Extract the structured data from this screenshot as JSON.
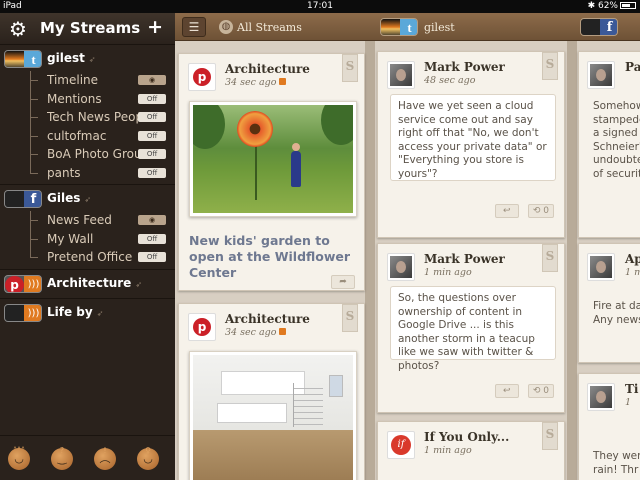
{
  "status": {
    "device": "iPad",
    "time": "17:01",
    "battery": "62%"
  },
  "sidebar": {
    "title": "My Streams",
    "accounts": [
      {
        "name": "gilest",
        "feeds": [
          {
            "label": "Timeline",
            "toggle": "on"
          },
          {
            "label": "Mentions",
            "toggle": "Off"
          },
          {
            "label": "Tech News People",
            "toggle": "Off"
          },
          {
            "label": "cultofmac",
            "toggle": "Off"
          },
          {
            "label": "BoA Photo Group",
            "toggle": "Off"
          },
          {
            "label": "pants",
            "toggle": "Off"
          }
        ]
      },
      {
        "name": "Giles",
        "feeds": [
          {
            "label": "News Feed",
            "toggle": "on"
          },
          {
            "label": "My Wall",
            "toggle": "Off"
          },
          {
            "label": "Pretend Office",
            "toggle": "Off"
          }
        ]
      },
      {
        "name": "Architecture",
        "feeds": []
      },
      {
        "name": "Life by",
        "feeds": []
      }
    ]
  },
  "header": {
    "col1": "All Streams",
    "col2": "gilest"
  },
  "cards": {
    "arch1": {
      "title": "Architecture",
      "time": "34 sec ago",
      "caption": "New kids' garden to open at the Wildflower Center"
    },
    "arch2": {
      "title": "Architecture",
      "time": "34 sec ago"
    },
    "mp1": {
      "title": "Mark Power",
      "time": "48 sec ago",
      "text": "Have we yet seen a cloud service come out and say right off that \"No, we don't access your private data\" or \"Everything you store is yours\"?",
      "count": "0"
    },
    "mp2": {
      "title": "Mark Power",
      "time": "1 min ago",
      "text": "So, the questions over ownership of content in Google Drive ... is this another storm in a teacup like we saw with twitter & photos?",
      "count": "0"
    },
    "if1": {
      "title": "If You Only...",
      "time": "1 min ago"
    },
    "peek1": {
      "title": "Pa",
      "lines": [
        "Somehow",
        "stampede",
        "a signed",
        "Schneier'",
        "undoubte",
        "of securit"
      ]
    },
    "peek2": {
      "title": "Ap",
      "time": "1 m",
      "lines": [
        "Fire at da",
        "Any news"
      ]
    },
    "peek3": {
      "title": "Ti",
      "time": "1",
      "lines": [
        "They wer",
        "rain! Thr"
      ]
    }
  }
}
